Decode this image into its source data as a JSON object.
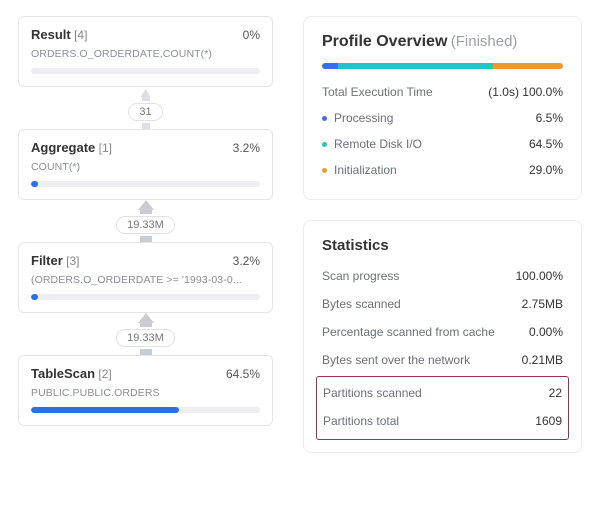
{
  "plan": {
    "nodes": [
      {
        "title": "Result",
        "idx": "[4]",
        "pct": "0%",
        "sub": "ORDERS.O_ORDERDATE,COUNT(*)",
        "fill": 0
      },
      {
        "title": "Aggregate",
        "idx": "[1]",
        "pct": "3.2%",
        "sub": "COUNT(*)",
        "fill": 3.2
      },
      {
        "title": "Filter",
        "idx": "[3]",
        "pct": "3.2%",
        "sub": "(ORDERS.O_ORDERDATE >= '1993-03-0...",
        "fill": 3.2
      },
      {
        "title": "TableScan",
        "idx": "[2]",
        "pct": "64.5%",
        "sub": "PUBLIC.PUBLIC.ORDERS",
        "fill": 64.5
      }
    ],
    "edges": [
      "31",
      "19.33M",
      "19.33M"
    ]
  },
  "profile": {
    "title": "Profile Overview",
    "status": "(Finished)",
    "total_label": "Total Execution Time",
    "total_value": "(1.0s) 100.0%",
    "items": [
      {
        "label": "Processing",
        "pct": "6.5%",
        "color": "#3a6ef0"
      },
      {
        "label": "Remote Disk I/O",
        "pct": "64.5%",
        "color": "#20c6c0"
      },
      {
        "label": "Initialization",
        "pct": "29.0%",
        "color": "#f09a2a"
      }
    ]
  },
  "stats": {
    "title": "Statistics",
    "rows": [
      {
        "label": "Scan progress",
        "value": "100.00%"
      },
      {
        "label": "Bytes scanned",
        "value": "2.75MB"
      },
      {
        "label": "Percentage scanned from cache",
        "value": "0.00%"
      },
      {
        "label": "Bytes sent over the network",
        "value": "0.21MB"
      }
    ],
    "highlight": [
      {
        "label": "Partitions scanned",
        "value": "22"
      },
      {
        "label": "Partitions total",
        "value": "1609"
      }
    ]
  }
}
